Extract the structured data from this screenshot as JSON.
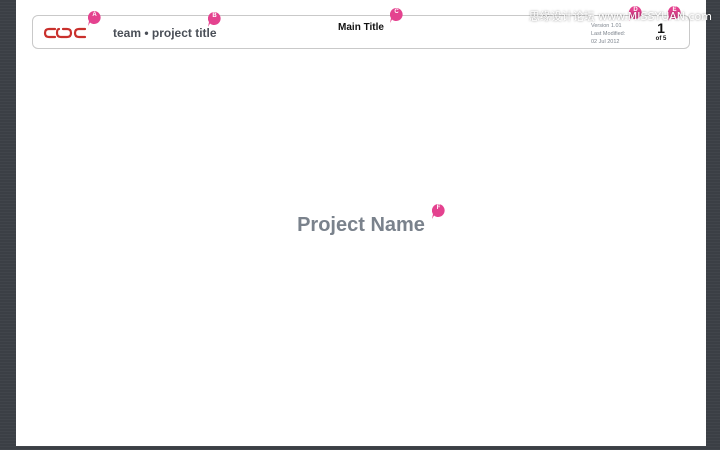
{
  "header": {
    "team_project": "team • project title",
    "main_title": "Main Title",
    "version": "Version 1.01",
    "last_modified_label": "Last Modified:",
    "last_modified_date": "02 Jul 2012",
    "page_current": "1",
    "page_of": "of 5"
  },
  "content": {
    "project_name": "Project Name"
  },
  "markers": [
    "A",
    "B",
    "C",
    "D",
    "E",
    "F"
  ],
  "watermark": "思缘设计论坛 www.MISSYUAN.com",
  "colors": {
    "marker": "#e4428f",
    "logo": "#c9302c",
    "project_name": "#7a828c",
    "background": "#3b3f45"
  }
}
